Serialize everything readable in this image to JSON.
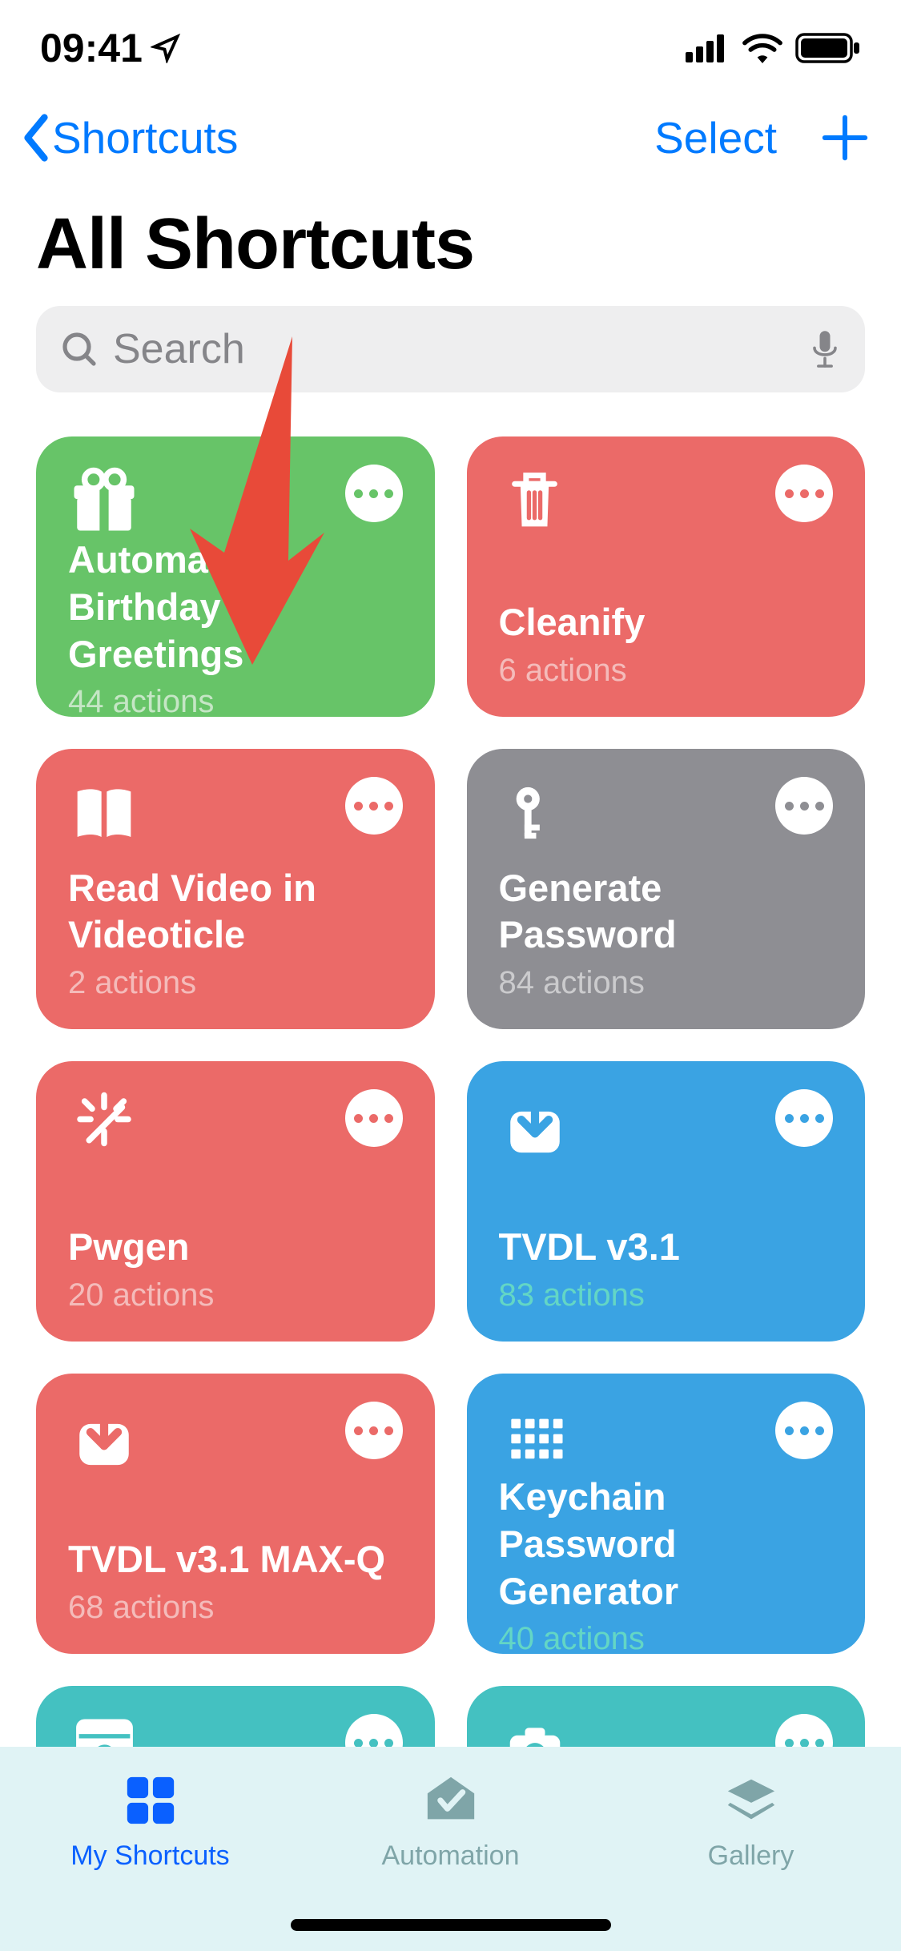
{
  "status": {
    "time": "09:41"
  },
  "nav": {
    "back_label": "Shortcuts",
    "select_label": "Select"
  },
  "page": {
    "title": "All Shortcuts"
  },
  "search": {
    "placeholder": "Search"
  },
  "cards": [
    {
      "title": "Automated Birthday Greetings",
      "sub": "44 actions",
      "bg": "#67c468",
      "icon": "gift",
      "dot": "#67c468",
      "sub_color": "#d6ecd6"
    },
    {
      "title": "Cleanify",
      "sub": "6 actions",
      "bg": "#eb6a68",
      "icon": "trash",
      "dot": "#eb6a68",
      "sub_color": "#f6cac9"
    },
    {
      "title": "Read Video in Videoticle",
      "sub": "2 actions",
      "bg": "#eb6a68",
      "icon": "book",
      "dot": "#eb6a68",
      "sub_color": "#f6cac9"
    },
    {
      "title": "Generate Password",
      "sub": "84 actions",
      "bg": "#8e8e93",
      "icon": "key",
      "dot": "#8e8e93",
      "sub_color": "#d6d6d8"
    },
    {
      "title": "Pwgen",
      "sub": "20 actions",
      "bg": "#eb6a68",
      "icon": "wand",
      "dot": "#eb6a68",
      "sub_color": "#f6cac9"
    },
    {
      "title": "TVDL v3.1",
      "sub": "83 actions",
      "bg": "#3aa3e3",
      "icon": "download",
      "dot": "#3aa3e3",
      "sub_color": "#6be0c0"
    },
    {
      "title": "TVDL v3.1 MAX-Q",
      "sub": "68 actions",
      "bg": "#eb6a68",
      "icon": "download",
      "dot": "#eb6a68",
      "sub_color": "#f6cac9"
    },
    {
      "title": "Keychain Password Generator",
      "sub": "40 actions",
      "bg": "#3aa3e3",
      "icon": "grid",
      "dot": "#3aa3e3",
      "sub_color": "#6be0c0"
    },
    {
      "title": "",
      "sub": "",
      "bg": "#44c1c1",
      "icon": "washer",
      "dot": "#44c1c1",
      "sub_color": "#bde9e9"
    },
    {
      "title": "",
      "sub": "",
      "bg": "#44c1c1",
      "icon": "camera",
      "dot": "#44c1c1",
      "sub_color": "#bde9e9"
    }
  ],
  "tabs": [
    {
      "label": "My Shortcuts",
      "icon": "squares",
      "active": true
    },
    {
      "label": "Automation",
      "icon": "clockcheck",
      "active": false
    },
    {
      "label": "Gallery",
      "icon": "stack",
      "active": false
    }
  ]
}
